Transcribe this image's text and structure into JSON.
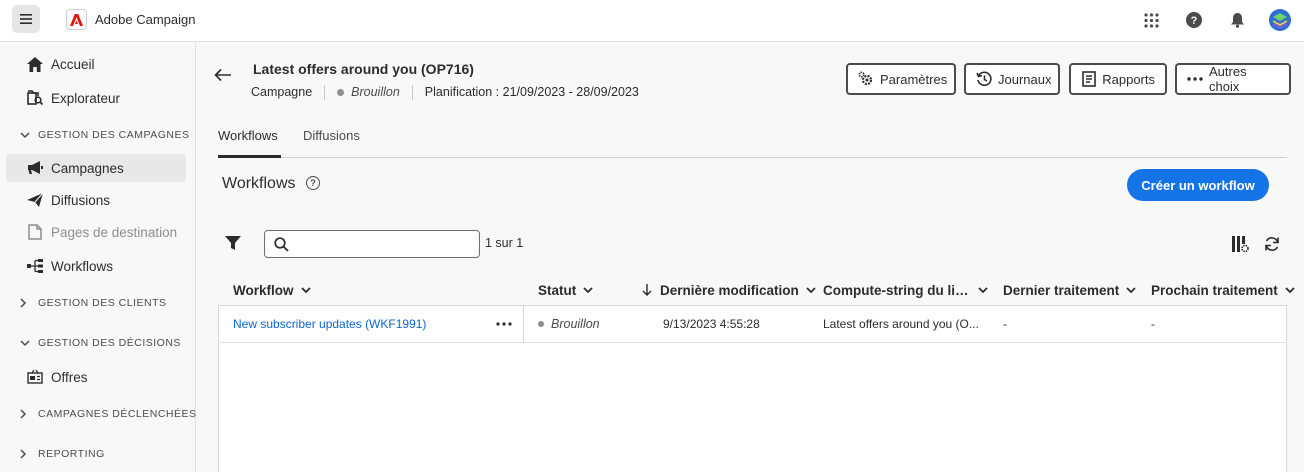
{
  "app": {
    "name": "Adobe Campaign"
  },
  "sidebar": {
    "items": [
      {
        "label": "Accueil",
        "icon": "home-icon"
      },
      {
        "label": "Explorateur",
        "icon": "explorer-icon"
      },
      {
        "label": "Campagnes",
        "icon": "megaphone-icon",
        "active": true
      },
      {
        "label": "Diffusions",
        "icon": "send-icon"
      },
      {
        "label": "Pages de destination",
        "icon": "page-icon",
        "disabled": true
      },
      {
        "label": "Workflows",
        "icon": "workflow-icon"
      },
      {
        "label": "Offres",
        "icon": "offers-icon"
      }
    ],
    "sections": {
      "campaigns": "GESTION DES CAMPAGNES",
      "clients": "GESTION DES CLIENTS",
      "decisions": "GESTION DES DÉCISIONS",
      "triggered": "CAMPAGNES DÉCLENCHÉES",
      "reporting": "REPORTING"
    }
  },
  "header": {
    "title": "Latest offers around you (OP716)",
    "type": "Campagne",
    "status": "Brouillon",
    "schedule": "Planification : 21/09/2023 - 28/09/2023",
    "buttons": {
      "settings": "Paramètres",
      "logs": "Journaux",
      "reports": "Rapports",
      "more": "Autres choix"
    }
  },
  "tabs": {
    "workflows": "Workflows",
    "deliveries": "Diffusions"
  },
  "section": {
    "title": "Workflows",
    "help": "?",
    "create_button": "Créer un workflow"
  },
  "search": {
    "placeholder": "",
    "value": ""
  },
  "pagination": {
    "count": "1 sur 1"
  },
  "table": {
    "columns": {
      "workflow": "Workflow",
      "status": "Statut",
      "modified": "Dernière modification",
      "compute": "Compute-string du lien...",
      "last_run": "Dernier traitement",
      "next_run": "Prochain traitement"
    },
    "rows": [
      {
        "workflow": "New subscriber updates (WKF1991)",
        "status": "Brouillon",
        "modified": "9/13/2023 4:55:28",
        "compute": "Latest offers around you (O...",
        "last_run": "-",
        "next_run": "-"
      }
    ]
  },
  "colors": {
    "accent": "#1473e6",
    "link": "#0d66d0",
    "status_draft": "#8e8e8e"
  }
}
